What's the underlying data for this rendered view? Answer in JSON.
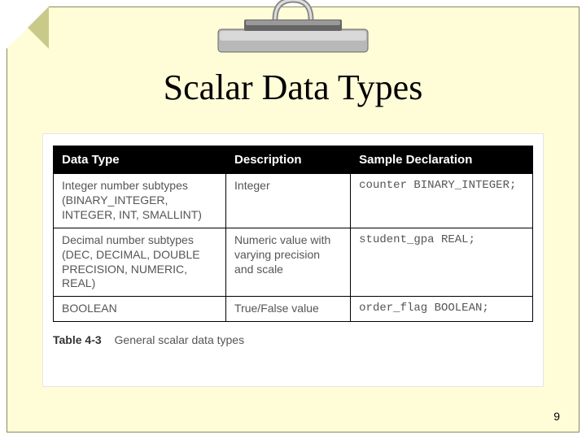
{
  "title": "Scalar Data Types",
  "page_number": "9",
  "table": {
    "headers": [
      "Data Type",
      "Description",
      "Sample Declaration"
    ],
    "rows": [
      {
        "datatype": "Integer number subtypes (BINARY_INTEGER, INTEGER, INT, SMALLINT)",
        "description": "Integer",
        "sample": "counter BINARY_INTEGER;"
      },
      {
        "datatype": "Decimal number subtypes (DEC, DECIMAL, DOUBLE PRECISION, NUMERIC, REAL)",
        "description": "Numeric value with varying precision and scale",
        "sample": "student_gpa REAL;"
      },
      {
        "datatype": "BOOLEAN",
        "description": "True/False value",
        "sample": "order_flag BOOLEAN;"
      }
    ]
  },
  "caption_label": "Table 4-3",
  "caption_text": "General scalar data types"
}
